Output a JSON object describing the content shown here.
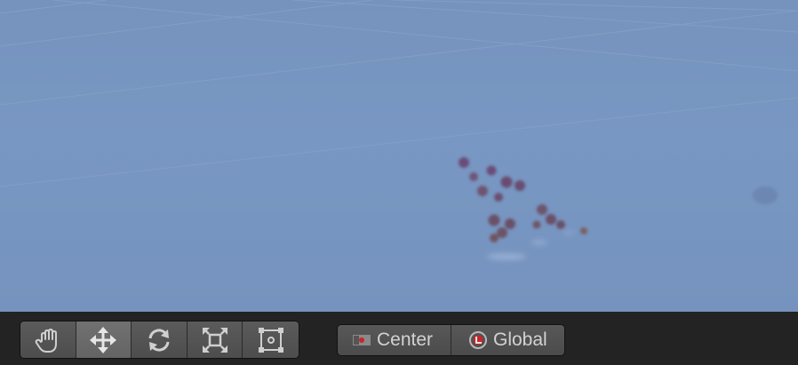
{
  "scene": {
    "background": "#7696c0",
    "grid_color": "#8aa6cc",
    "particle_color": "#5c4a6e"
  },
  "toolbar": {
    "tools": [
      {
        "name": "hand-tool",
        "icon": "hand-icon",
        "active": false
      },
      {
        "name": "move-tool",
        "icon": "move-arrows-icon",
        "active": true
      },
      {
        "name": "rotate-tool",
        "icon": "rotate-icon",
        "active": false
      },
      {
        "name": "scale-tool",
        "icon": "scale-icon",
        "active": false
      },
      {
        "name": "rect-tool",
        "icon": "rect-transform-icon",
        "active": false
      }
    ],
    "pivot_mode_label": "Center",
    "pivot_rotation_label": "Global"
  }
}
